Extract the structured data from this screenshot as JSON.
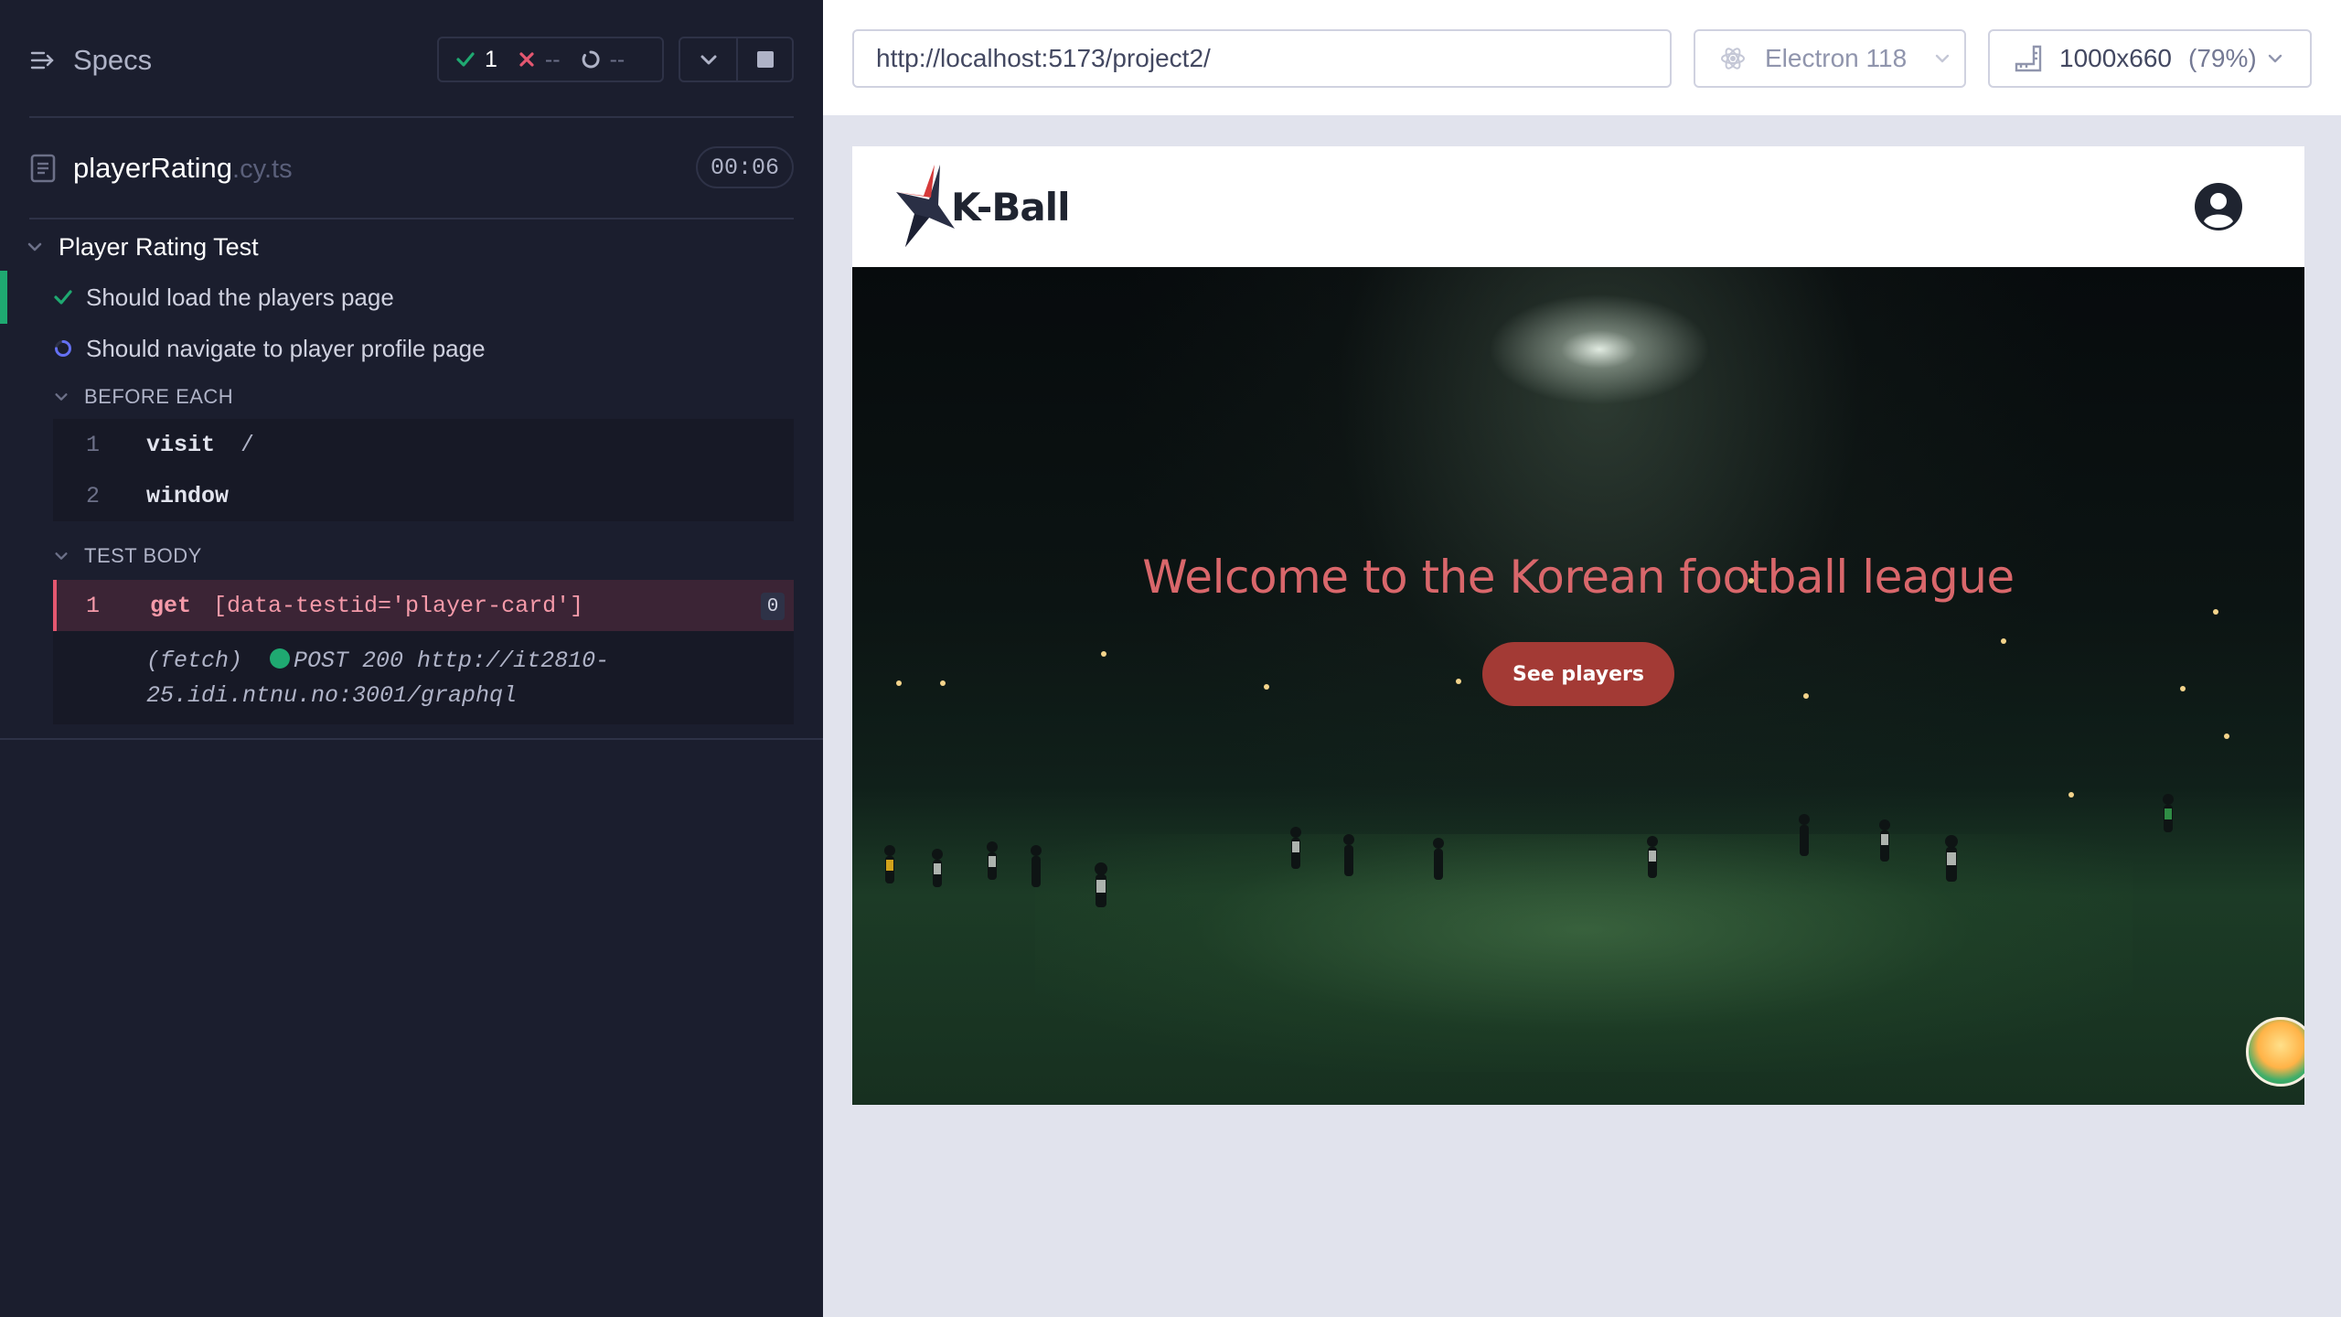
{
  "reporter": {
    "specs_label": "Specs",
    "stats": {
      "passed": "1",
      "failed": "--",
      "pending": "--"
    },
    "spec": {
      "name": "playerRating",
      "ext": ".cy.ts",
      "duration": "00:06"
    },
    "suite": {
      "title": "Player Rating Test",
      "tests": [
        {
          "title": "Should load the players page",
          "state": "passed"
        },
        {
          "title": "Should navigate to player profile page",
          "state": "running"
        }
      ],
      "before_each": {
        "label": "BEFORE EACH",
        "commands": [
          {
            "num": "1",
            "name": "visit",
            "arg": "/"
          },
          {
            "num": "2",
            "name": "window",
            "arg": ""
          }
        ]
      },
      "test_body": {
        "label": "TEST BODY",
        "commands": [
          {
            "num": "1",
            "name": "get",
            "arg": "[data-testid='player-card']",
            "count": "0"
          }
        ],
        "fetch": {
          "prefix": "(fetch)",
          "line1": "POST 200 http://it2810-",
          "line2": "25.idi.ntnu.no:3001/graphql"
        }
      }
    }
  },
  "aut_bar": {
    "url": "http://localhost:5173/project2/",
    "browser": "Electron 118",
    "viewport": "1000x660",
    "viewport_pct": "(79%)"
  },
  "app": {
    "logo_text": "K-Ball",
    "hero_title": "Welcome to the Korean football league",
    "hero_button": "See players"
  },
  "colors": {
    "accent_pink": "#e45770",
    "pass_green": "#1fa971",
    "hero_title": "#d9676b",
    "hero_button": "#a33a35"
  },
  "icons": [
    "specs-icon",
    "check-icon",
    "x-icon",
    "spinner-icon",
    "chevron-down-icon",
    "stop-icon",
    "file-icon",
    "electron-icon",
    "ruler-icon",
    "user-circle-icon",
    "kball-star-logo"
  ]
}
